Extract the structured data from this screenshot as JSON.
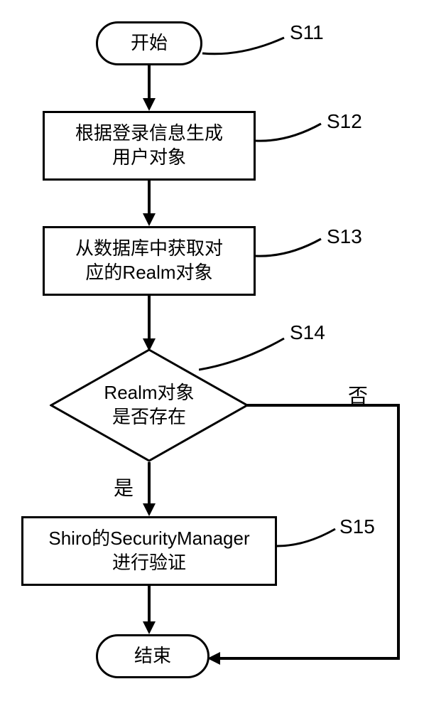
{
  "nodes": {
    "start": "开始",
    "s12": "根据登录信息生成\n用户对象",
    "s13": "从数据库中获取对\n应的Realm对象",
    "s14": "Realm对象\n是否存在",
    "s15": "Shiro的SecurityManager\n进行验证",
    "end": "结束"
  },
  "labels": {
    "s11": "S11",
    "s12": "S12",
    "s13": "S13",
    "s14": "S14",
    "s15": "S15",
    "yes": "是",
    "no": "否"
  },
  "chart_data": {
    "type": "flowchart",
    "nodes": [
      {
        "id": "start",
        "type": "terminal",
        "text": "开始",
        "label": "S11"
      },
      {
        "id": "s12",
        "type": "process",
        "text": "根据登录信息生成用户对象",
        "label": "S12"
      },
      {
        "id": "s13",
        "type": "process",
        "text": "从数据库中获取对应的Realm对象",
        "label": "S13"
      },
      {
        "id": "s14",
        "type": "decision",
        "text": "Realm对象是否存在",
        "label": "S14"
      },
      {
        "id": "s15",
        "type": "process",
        "text": "Shiro的SecurityManager进行验证",
        "label": "S15"
      },
      {
        "id": "end",
        "type": "terminal",
        "text": "结束"
      }
    ],
    "edges": [
      {
        "from": "start",
        "to": "s12"
      },
      {
        "from": "s12",
        "to": "s13"
      },
      {
        "from": "s13",
        "to": "s14"
      },
      {
        "from": "s14",
        "to": "s15",
        "label": "是"
      },
      {
        "from": "s14",
        "to": "end",
        "label": "否"
      },
      {
        "from": "s15",
        "to": "end"
      }
    ]
  }
}
